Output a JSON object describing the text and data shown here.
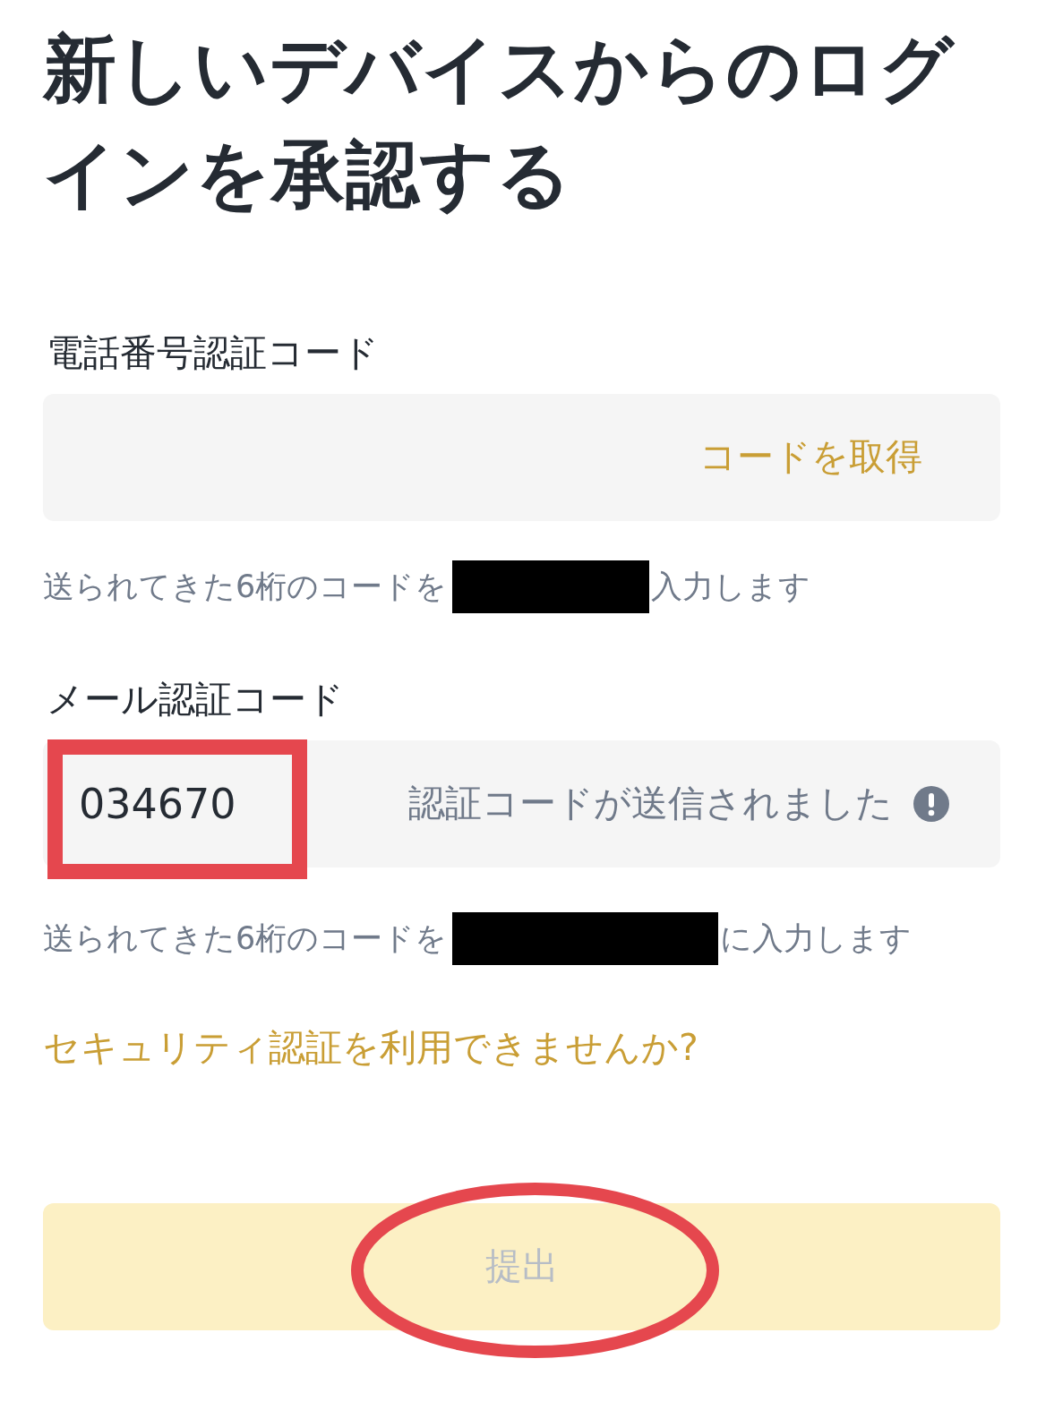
{
  "title": "新しいデバイスからのログインを承認する",
  "fields": [
    {
      "label": "電話番号認証コード",
      "action": "コードを取得",
      "hint": {
        "before": "送られてきた6桁のコードを",
        "redacted": true,
        "after": "入力します"
      }
    },
    {
      "label": "メール認証コード",
      "value": "034670",
      "highlighted": true,
      "status": "認証コードが送信されました",
      "hint": {
        "before": "送られてきた6桁のコードを",
        "redacted": true,
        "after": "に入力します"
      }
    }
  ],
  "help_link": "セキュリティ認証を利用できませんか?",
  "submit": {
    "label": "提出",
    "disabled": true,
    "circled": true
  }
}
